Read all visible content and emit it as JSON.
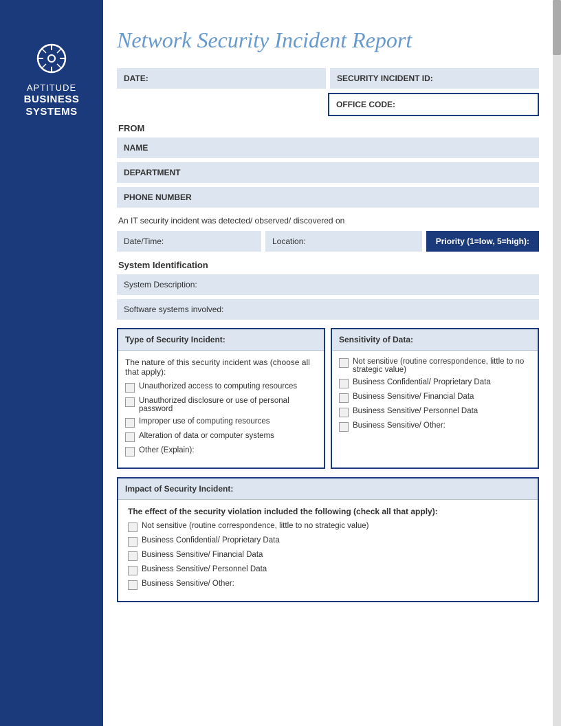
{
  "sidebar": {
    "aptitude": "APTITUDE",
    "business": "BUSINESS",
    "systems": "SYSTEMS"
  },
  "header": {
    "title": "Network Security Incident Report"
  },
  "form": {
    "date_label": "DATE:",
    "security_incident_id_label": "SECURITY INCIDENT ID:",
    "office_code_label": "OFFICE CODE:",
    "from_label": "FROM",
    "name_label": "NAME",
    "department_label": "DEPARTMENT",
    "phone_label": "PHONE NUMBER",
    "incident_text": "An IT security incident was detected/ observed/ discovered on",
    "date_time_label": "Date/Time:",
    "location_label": "Location:",
    "priority_label": "Priority (1=low, 5=high):",
    "system_identification_label": "System Identification",
    "system_description_label": "System Description:",
    "software_systems_label": "Software systems involved:",
    "type_of_incident_label": "Type of Security Incident:",
    "sensitivity_label": "Sensitivity of Data:",
    "nature_text": "The nature of this security incident was (choose all that apply):",
    "type_checkboxes": [
      "Unauthorized access to computing resources",
      "Unauthorized disclosure or use of personal password",
      "Improper use of computing resources",
      "Alteration of data or computer systems",
      "Other (Explain):"
    ],
    "sensitivity_checkboxes": [
      "Not sensitive (routine correspondence, little to no strategic value)",
      "Business Confidential/ Proprietary Data",
      "Business Sensitive/ Financial Data",
      "Business Sensitive/ Personnel Data",
      "Business Sensitive/ Other:"
    ],
    "impact_label": "Impact of Security Incident:",
    "effect_text": "The effect of the security violation included the following (check all that apply):",
    "impact_checkboxes": [
      "Not sensitive (routine correspondence, little to no strategic value)",
      "Business Confidential/ Proprietary Data",
      "Business Sensitive/ Financial Data",
      "Business Sensitive/ Personnel Data",
      "Business Sensitive/ Other:"
    ]
  }
}
